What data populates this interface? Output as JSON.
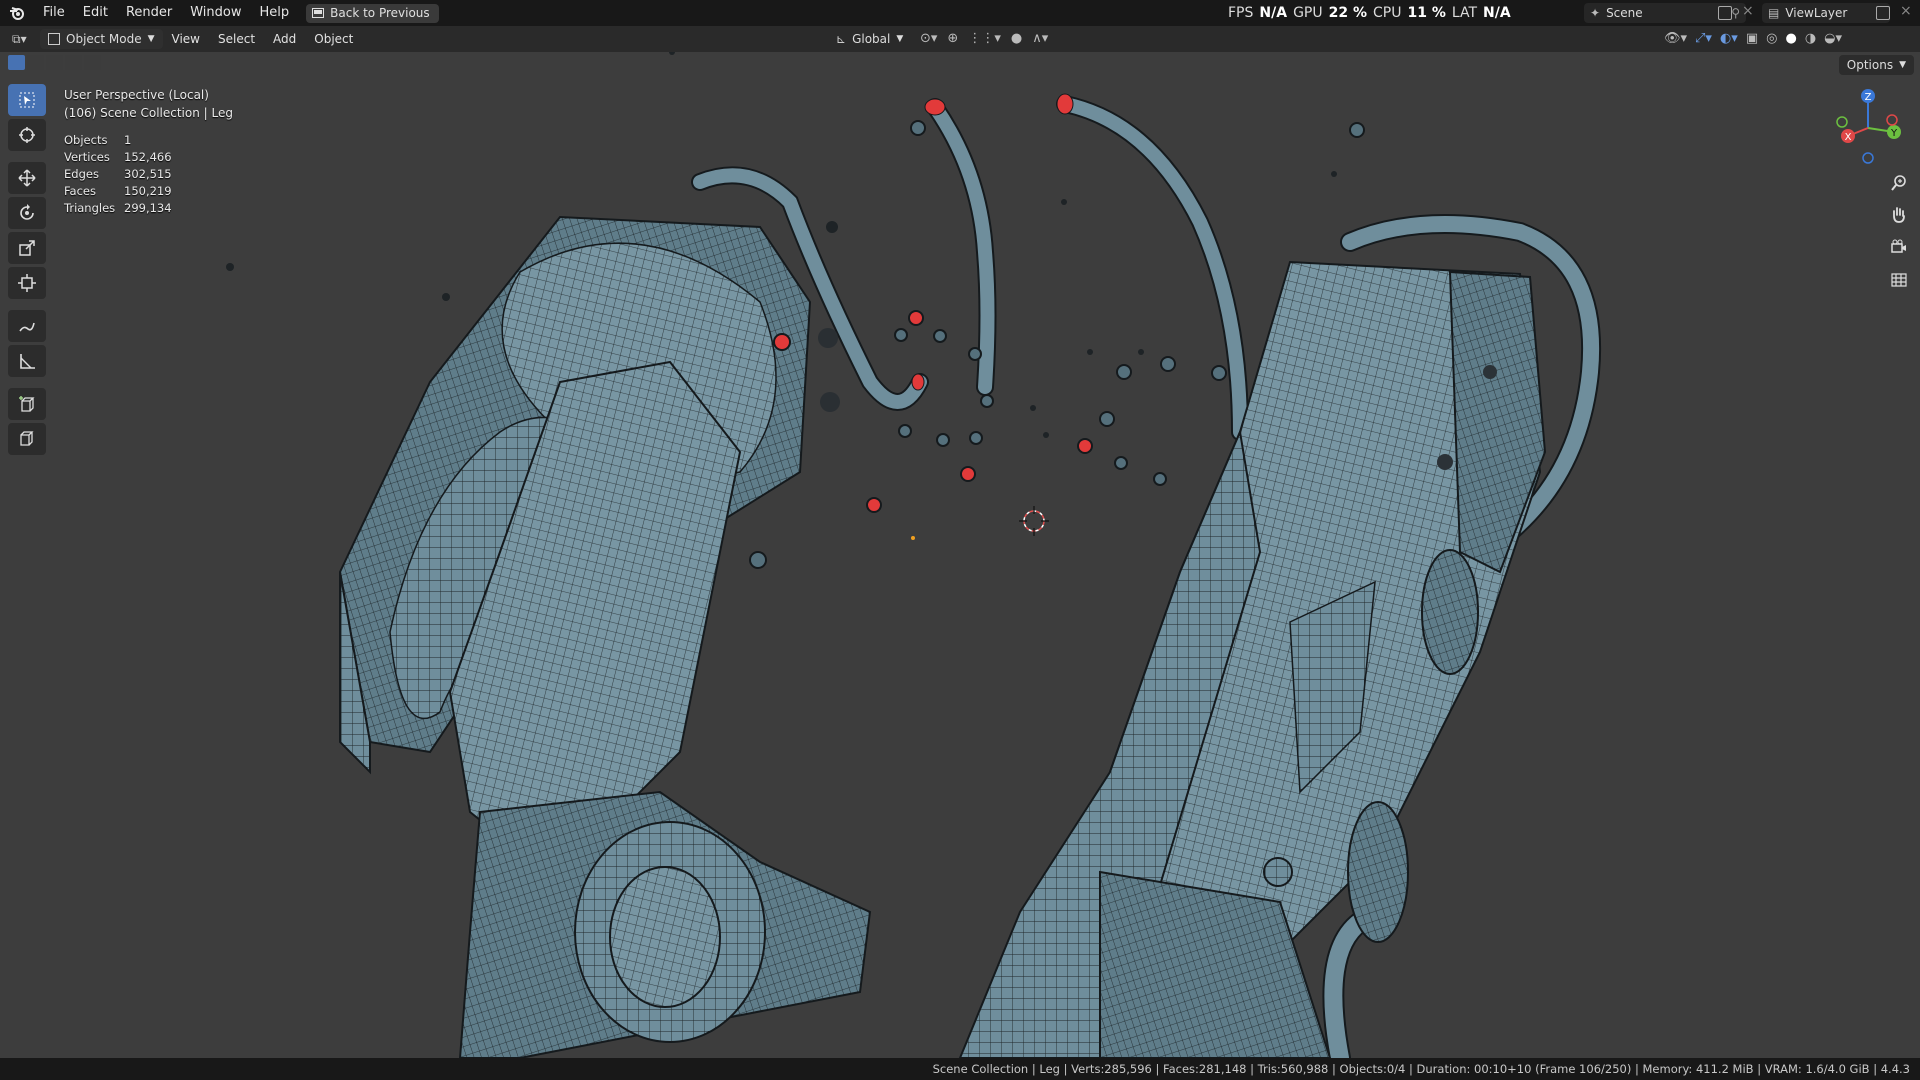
{
  "menu": {
    "file": "File",
    "edit": "Edit",
    "render": "Render",
    "window": "Window",
    "help": "Help",
    "back_to_previous": "Back to Previous"
  },
  "perf": {
    "fps_label": "FPS",
    "fps_value": "N/A",
    "gpu_label": "GPU",
    "gpu_value": "22 %",
    "cpu_label": "CPU",
    "cpu_value": "11 %",
    "lat_label": "LAT",
    "lat_value": "N/A"
  },
  "scene": {
    "name": "Scene",
    "view_layer": "ViewLayer"
  },
  "header": {
    "mode": "Object Mode",
    "view": "View",
    "select": "Select",
    "add": "Add",
    "object": "Object",
    "transform_orientation": "Global",
    "options": "Options"
  },
  "overlay": {
    "view_name": "User Perspective (Local)",
    "collection": "(106) Scene Collection | Leg",
    "stats": [
      {
        "label": "Objects",
        "value": "1"
      },
      {
        "label": "Vertices",
        "value": "152,466"
      },
      {
        "label": "Edges",
        "value": "302,515"
      },
      {
        "label": "Faces",
        "value": "150,219"
      },
      {
        "label": "Triangles",
        "value": "299,134"
      }
    ]
  },
  "status_bar": {
    "text": "Scene Collection | Leg | Verts:285,596 | Faces:281,148 | Tris:560,988 | Objects:0/4 | Duration: 00:10+10 (Frame 106/250) | Memory: 411.2 MiB | VRAM: 1.6/4.0 GiB | 4.4.3"
  },
  "colors": {
    "mesh_fill": "#6f8e9c",
    "mesh_wire": "#1d2226",
    "selected": "#e23a3a",
    "accent": "#4772b3",
    "viewport_bg": "#3d3d3d"
  },
  "gizmo": {
    "x": "X",
    "y": "Y",
    "z": "Z"
  }
}
